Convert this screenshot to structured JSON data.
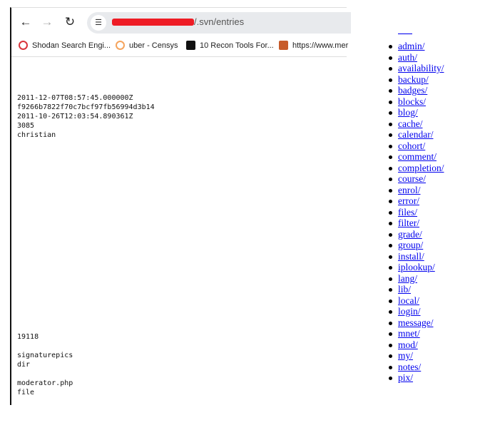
{
  "browser": {
    "url_suffix": "/.svn/entries",
    "back_icon": "arrow-left-icon",
    "forward_icon": "arrow-right-icon",
    "reload_icon": "reload-icon",
    "site_settings_icon": "tune-icon",
    "bookmarks": [
      {
        "label": "Shodan Search Engi...",
        "icon": "shodan-icon",
        "color": "#d9353b"
      },
      {
        "label": "uber - Censys",
        "icon": "censys-icon",
        "color": "#f5a45d"
      },
      {
        "label": "10 Recon Tools For...",
        "icon": "medium-icon",
        "color": "#111111"
      },
      {
        "label": "https://www.mer",
        "icon": "site-icon",
        "color": "#c75b2a"
      }
    ]
  },
  "entries": {
    "block1": [
      "2011-12-07T08:57:45.000000Z",
      "f9266b7822f70c7bcf97fb56994d3b14",
      "2011-10-26T12:03:54.890361Z",
      "3085",
      "christian"
    ],
    "block2": [
      "19118",
      "",
      "signaturepics",
      "dir",
      "",
      "moderator.php",
      "file"
    ]
  },
  "directory_list": [
    "admin/",
    "auth/",
    "availability/",
    "backup/",
    "badges/",
    "blocks/",
    "blog/",
    "cache/",
    "calendar/",
    "cohort/",
    "comment/",
    "completion/",
    "course/",
    "enrol/",
    "error/",
    "files/",
    "filter/",
    "grade/",
    "group/",
    "install/",
    "iplookup/",
    "lang/",
    "lib/",
    "local/",
    "login/",
    "message/",
    "mnet/",
    "mod/",
    "my/",
    "notes/",
    "pix/"
  ]
}
